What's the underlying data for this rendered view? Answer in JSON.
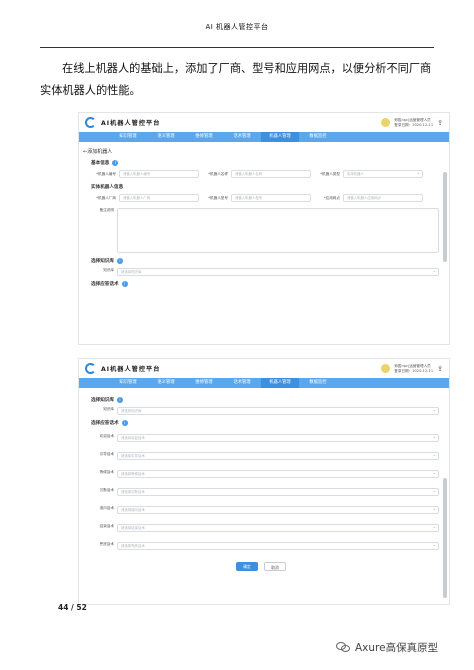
{
  "header": {
    "title": "AI 机器人管控平台"
  },
  "intro": "在线上机器人的基础上，添加了厂商、型号和应用网点，以便分析不同厂商实体机器人的性能。",
  "app": {
    "title": "AI机器人管控平台",
    "user_line1": "师胜npc|运营管理人员",
    "user_line2": "登录日期：2020-12-11",
    "nav": [
      "知识管理",
      "语义管理",
      "维修管理",
      "话术管理",
      "机器人管理",
      "数据监控"
    ],
    "active_nav": 4
  },
  "shot1": {
    "back": "←添加机器人",
    "basic_title": "基本信息",
    "basic_fields": [
      {
        "label": "*机器人编号",
        "placeholder": "请输入机器人编号"
      },
      {
        "label": "*机器人名称",
        "placeholder": "请输入机器人名称"
      },
      {
        "label": "*机器人类型",
        "placeholder": "实体机器人"
      }
    ],
    "entity_title": "实体机器人信息",
    "entity_fields": [
      {
        "label": "*机器人厂商",
        "placeholder": "请输入机器人厂商"
      },
      {
        "label": "*机器人型号",
        "placeholder": "请输入机器人型号"
      },
      {
        "label": "*应用网点",
        "placeholder": "请输入机器人应用网点"
      }
    ],
    "remark_label": "备注说明",
    "kb_title": "选择知识库",
    "kb_label": "知识库",
    "kb_placeholder": "请选择知识库",
    "script_title": "选择应答话术"
  },
  "shot2": {
    "kb_title": "选择知识库",
    "kb_label": "知识库",
    "kb_placeholder": "请选择知识库",
    "script_title": "选择应答话术",
    "scripts": [
      {
        "label": "欢迎话术",
        "placeholder": "请选择欢迎话术"
      },
      {
        "label": "引导话术",
        "placeholder": "请选择引导话术"
      },
      {
        "label": "等候话术",
        "placeholder": "请选择等候话术"
      },
      {
        "label": "沉默话术",
        "placeholder": "请选择沉默话术"
      },
      {
        "label": "追问话术",
        "placeholder": "请选择追问话术"
      },
      {
        "label": "结束话术",
        "placeholder": "请选择结束话术"
      },
      {
        "label": "兜底话术",
        "placeholder": "请选择兜底话术"
      }
    ],
    "confirm": "确定",
    "cancel": "取消"
  },
  "page_number": "44 / 52",
  "watermark": "Axure高保真原型",
  "colors": {
    "accent": "#3d8fe0",
    "nav": "#5aa7ee"
  }
}
